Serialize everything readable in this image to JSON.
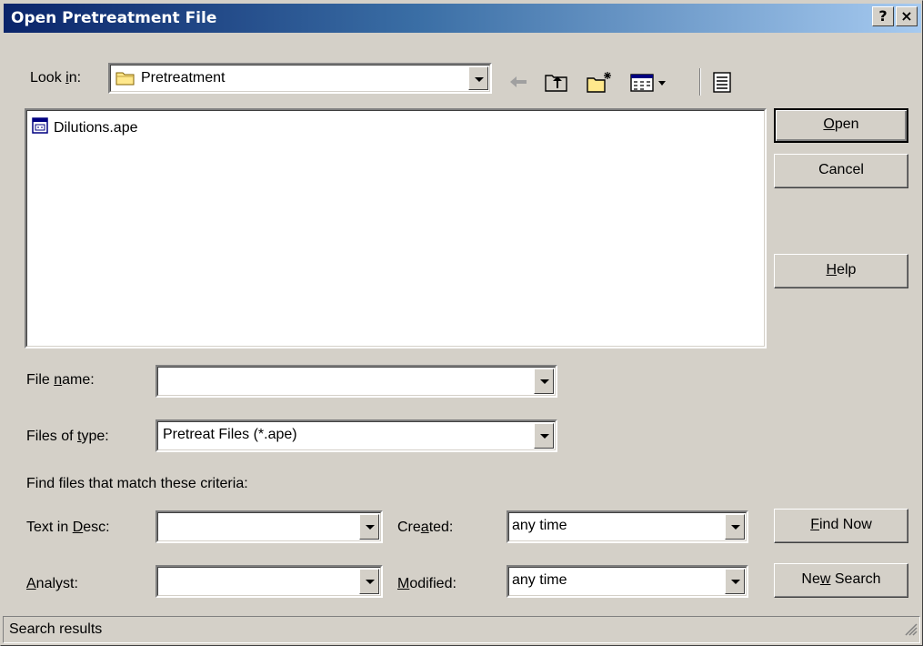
{
  "window": {
    "title": "Open Pretreatment File",
    "help_btn": "?",
    "close_btn": "×"
  },
  "look_in": {
    "label_pre": "Look ",
    "label_u": "i",
    "label_post": "n:",
    "value": "Pretreatment"
  },
  "toolbar_icons": [
    "back-icon",
    "up-folder-icon",
    "new-folder-icon",
    "view-menu-icon",
    "details-icon"
  ],
  "file_list": {
    "items": [
      {
        "name": "Dilutions.ape",
        "icon": "ape-file-icon"
      }
    ]
  },
  "buttons": {
    "open_u": "O",
    "open_rest": "pen",
    "cancel": "Cancel",
    "help_u": "H",
    "help_rest": "elp",
    "find_now_u": "F",
    "find_now_rest": "ind Now",
    "new_search_pre": "Ne",
    "new_search_u": "w",
    "new_search_post": " Search"
  },
  "file_name": {
    "label_pre": "File ",
    "label_u": "n",
    "label_post": "ame:",
    "value": ""
  },
  "files_of_type": {
    "label_pre": "Files of ",
    "label_u": "t",
    "label_post": "ype:",
    "value": "Pretreat Files (*.ape)"
  },
  "criteria": {
    "heading": "Find files that match these criteria:",
    "text_in_desc_pre": "Text in ",
    "text_in_desc_u": "D",
    "text_in_desc_post": "esc:",
    "text_in_desc_value": "",
    "analyst_u": "A",
    "analyst_rest": "nalyst:",
    "analyst_value": "",
    "created_pre": "Cre",
    "created_u": "a",
    "created_post": "ted:",
    "created_value": "any time",
    "modified_u": "M",
    "modified_rest": "odified:",
    "modified_value": "any time"
  },
  "status_bar": {
    "text": "Search results"
  }
}
